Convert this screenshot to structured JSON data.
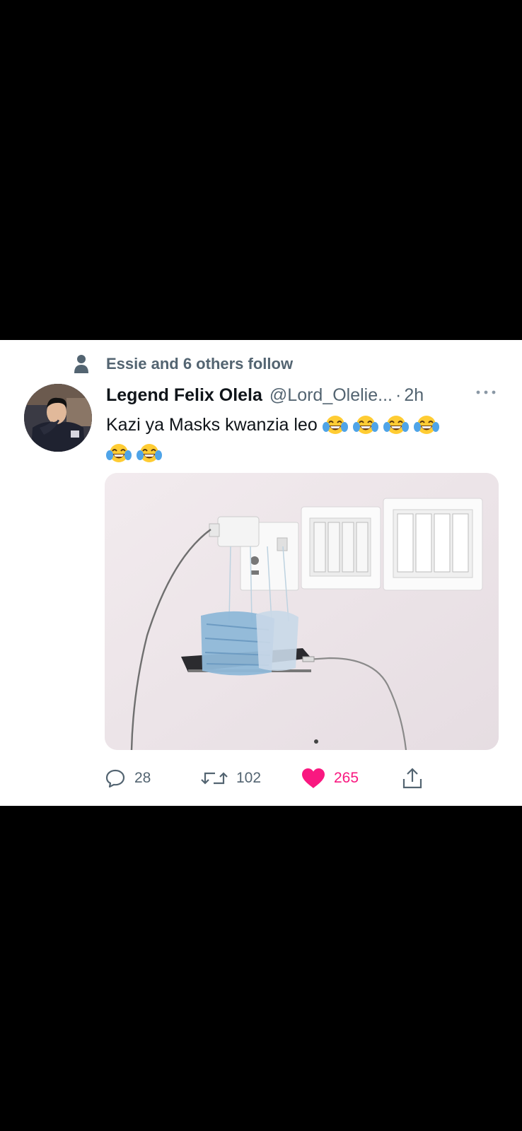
{
  "social_context": {
    "text": "Essie and 6 others follow",
    "icon": "person-icon"
  },
  "tweet": {
    "author_name": "Legend Felix Olela",
    "handle": "@Lord_Olelie...",
    "separator": "·",
    "time": "2h",
    "text": "Kazi ya Masks kwanzia leo",
    "emoji": "tears-of-joy-emoji",
    "emoji_count_line1": 4,
    "emoji_count_line2": 2,
    "media_icon": "photo"
  },
  "actions": {
    "replies": "28",
    "retweets": "102",
    "likes": "265",
    "liked": true,
    "like_color": "#f91880"
  },
  "colors": {
    "text_primary": "#0f1419",
    "text_secondary": "#536471",
    "background": "#000000"
  }
}
